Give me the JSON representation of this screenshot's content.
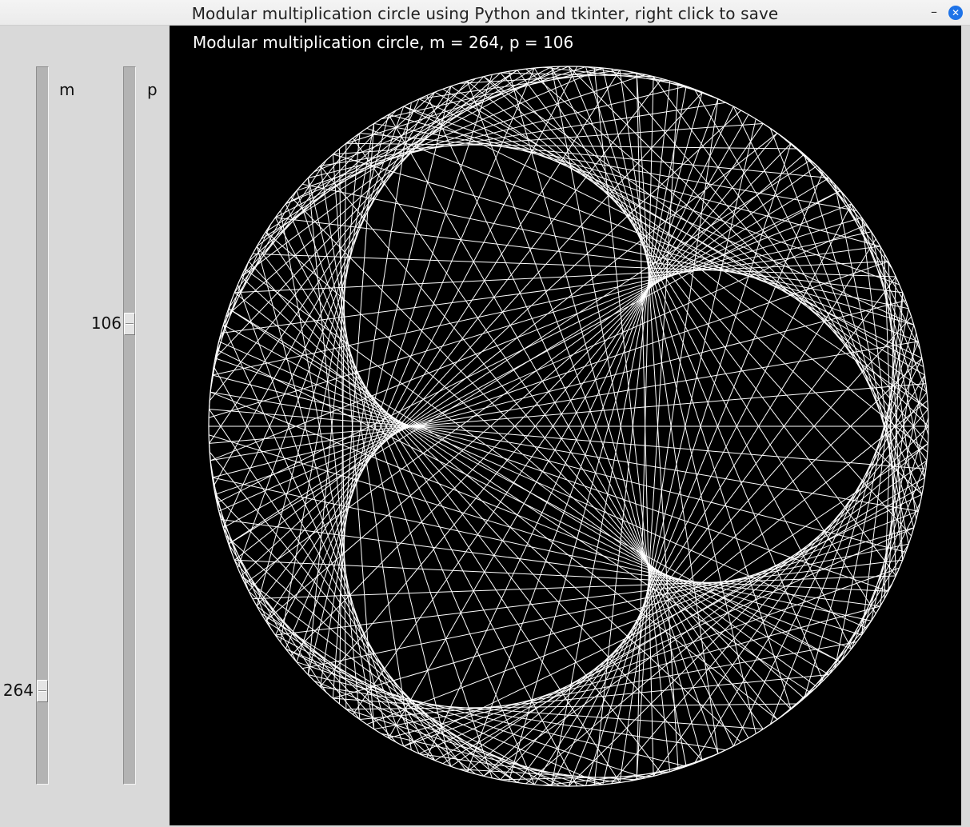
{
  "window": {
    "title": "Modular multiplication circle using Python and tkinter, right click to save",
    "minimize_glyph": "–",
    "close_glyph": "✕"
  },
  "sliders": {
    "m": {
      "label": "m",
      "value": 264,
      "value_text": "264",
      "min": 0,
      "max": 300
    },
    "p": {
      "label": "p",
      "value": 106,
      "value_text": "106",
      "min": 0,
      "max": 300
    }
  },
  "canvas": {
    "caption": "Modular multiplication circle, m = 264, p = 106",
    "background": "#000000",
    "line_color": "#ffffff"
  }
}
